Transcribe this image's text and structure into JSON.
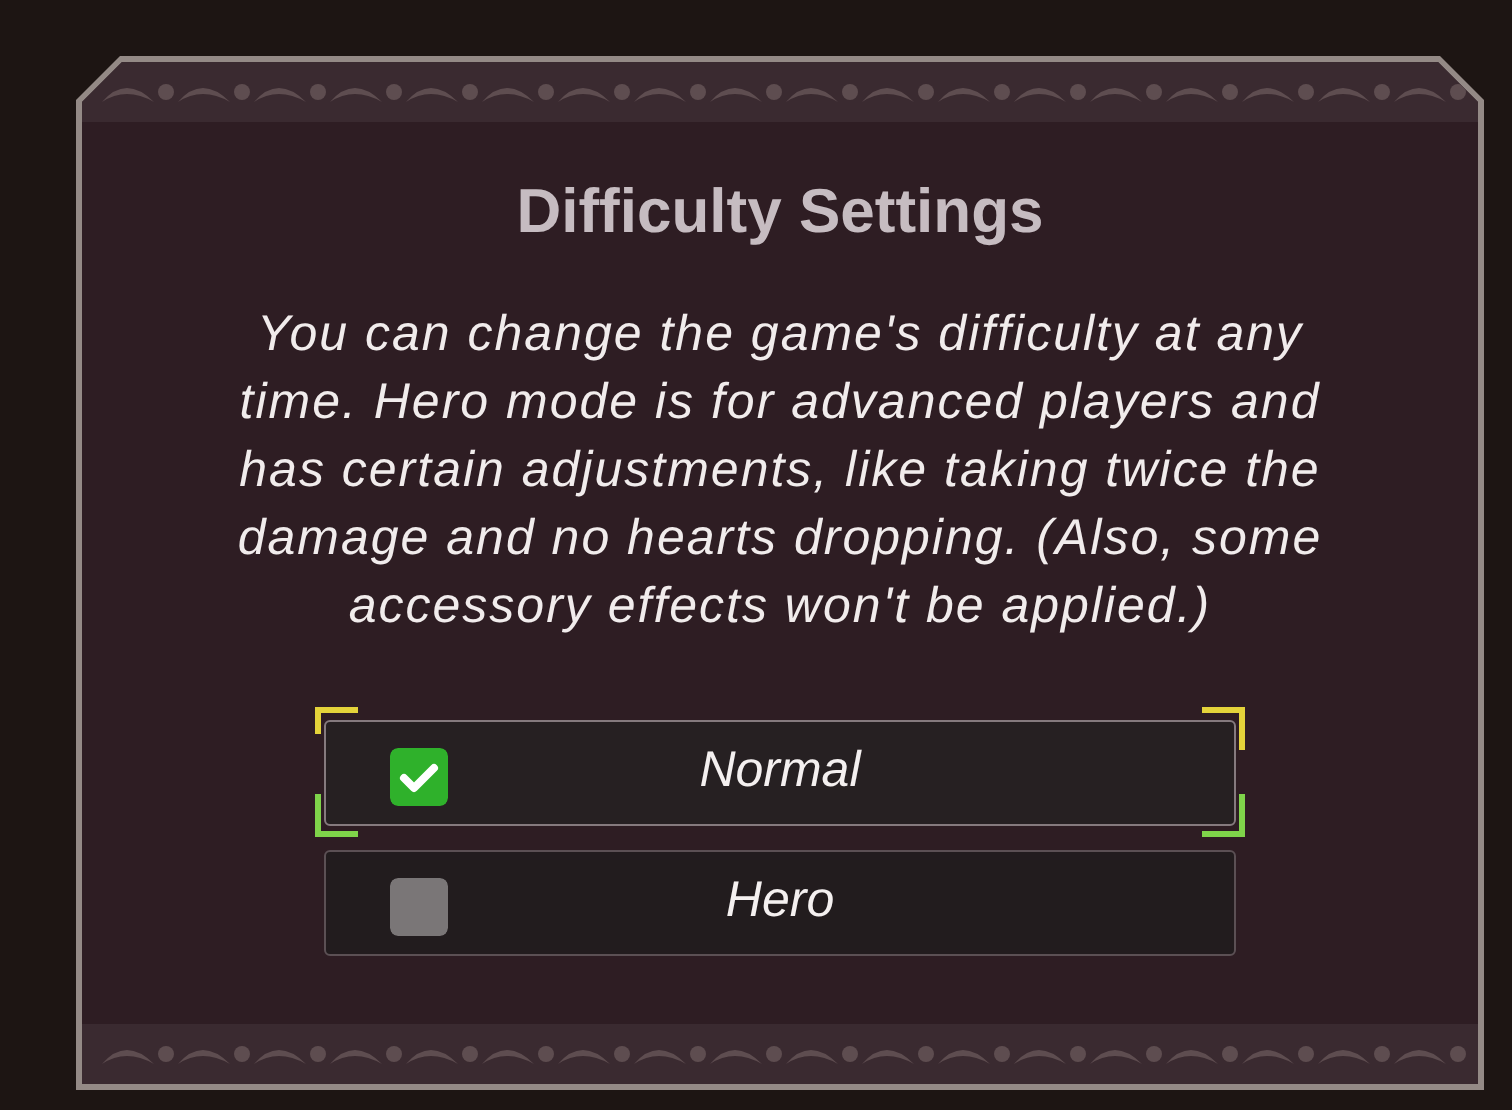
{
  "dialog": {
    "title": "Difficulty Settings",
    "message": "You can change the game's difficulty at any time. Hero mode is for advanced players and has certain adjustments, like taking twice the damage and no hearts dropping. (Also, some accessory effects won't be applied.)",
    "options": [
      {
        "label": "Normal",
        "checked": true,
        "selected": true
      },
      {
        "label": "Hero",
        "checked": false,
        "selected": false
      }
    ]
  }
}
